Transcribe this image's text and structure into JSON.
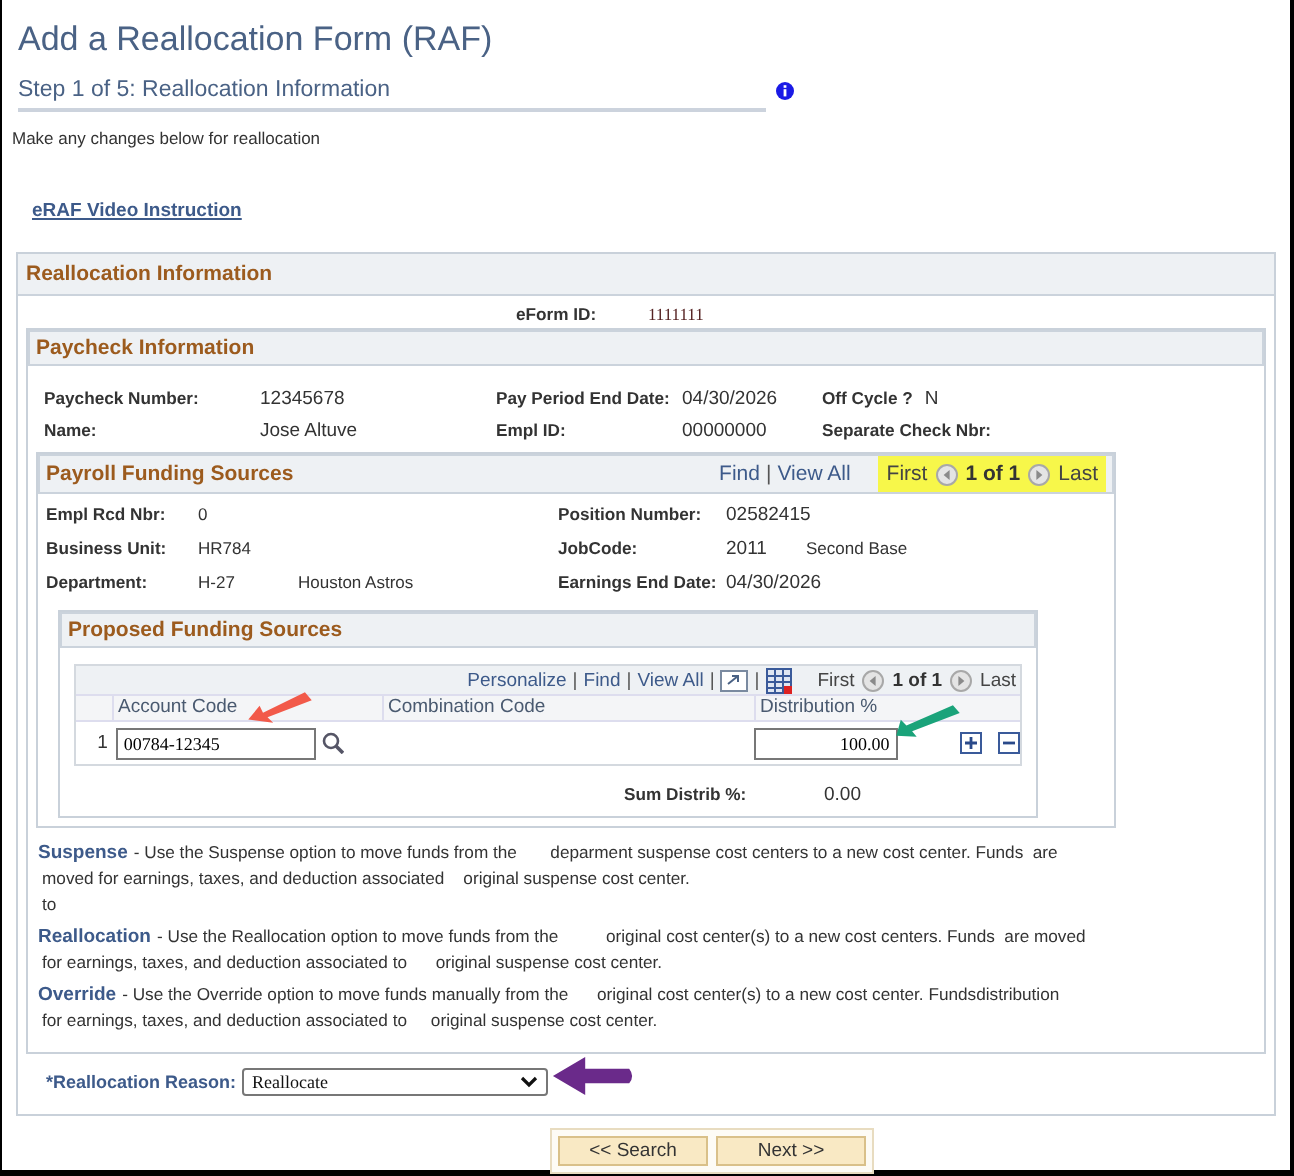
{
  "title": "Add a Reallocation Form (RAF)",
  "step": {
    "label": "Step 1 of 5: Reallocation Information"
  },
  "instructions": "Make any changes below for reallocation",
  "video_link": "eRAF Video Instruction",
  "section": {
    "title": "Reallocation Information",
    "eform": {
      "label": "eForm ID:",
      "value": "1111111"
    }
  },
  "paycheck": {
    "title": "Paycheck Information",
    "rows": [
      [
        {
          "label": "Paycheck Number:",
          "value": "12345678"
        },
        {
          "label": "Pay Period End Date:",
          "value": "04/30/2026"
        },
        {
          "label": "Off Cycle ?",
          "value": "N"
        }
      ],
      [
        {
          "label": "Name:",
          "value": "Jose Altuve"
        },
        {
          "label": "Empl ID:",
          "value": "00000000"
        },
        {
          "label": "Separate Check Nbr:"
        }
      ]
    ]
  },
  "payroll": {
    "title": "Payroll Funding Sources",
    "toolbar": [
      {
        "kind": "link",
        "text": "Find"
      },
      {
        "kind": "separator",
        "text": "|"
      },
      {
        "kind": "link",
        "text": "View All"
      }
    ],
    "nav": {
      "first": "First",
      "count": "1 of 1",
      "last": "Last",
      "highlighted": true
    },
    "rows": [
      [
        {
          "label": "Empl Rcd Nbr:",
          "value": "0"
        },
        {
          "label": "Position Number:",
          "value": "02582415"
        }
      ],
      [
        {
          "label": "Business Unit:",
          "value": "HR784"
        },
        {
          "label": "JobCode:",
          "value": "2011",
          "description": "Second Base"
        }
      ],
      [
        {
          "label": "Department:",
          "value": "H-27",
          "description": "Houston Astros"
        },
        {
          "label": "Earnings End Date:",
          "value": "04/30/2026"
        }
      ]
    ]
  },
  "proposed": {
    "title": "Proposed Funding Sources",
    "toolbar": [
      {
        "kind": "link",
        "text": "Personalize"
      },
      {
        "kind": "separator",
        "text": "|"
      },
      {
        "kind": "link",
        "text": "Find"
      },
      {
        "kind": "separator",
        "text": "|"
      },
      {
        "kind": "link",
        "text": "View All"
      },
      {
        "kind": "separator",
        "text": "|"
      },
      {
        "kind": "zoom"
      },
      {
        "kind": "separator",
        "text": "|"
      },
      {
        "kind": "spreadsheet"
      }
    ],
    "nav": {
      "first": "First",
      "count": "1 of 1",
      "last": "Last",
      "highlighted": false
    },
    "columns": [
      "Account Code",
      "Combination Code",
      "Distribution %"
    ],
    "rows": [
      {
        "number": "1",
        "account_code": "00784-12345",
        "distribution": "100.00"
      }
    ],
    "sum": {
      "label": "Sum Distrib %:",
      "value": "0.00"
    }
  },
  "descriptions": [
    {
      "term": "Suspense",
      "lines": [
        "- Use the Suspense option to move funds from the       deparment suspense cost centers to a new cost center. Funds  are",
        "moved for earnings, taxes, and deduction associated    original suspense cost center.",
        "to"
      ]
    },
    {
      "term": "Reallocation",
      "lines": [
        "- Use the Reallocation option to move funds from the          original cost center(s) to a new cost centers. Funds  are moved",
        "for earnings, taxes, and deduction associated to      original suspense cost center."
      ]
    },
    {
      "term": "Override",
      "lines": [
        "- Use the Override option to move funds manually from the      original cost center(s) to a new cost center. Fundsdistribution",
        "for earnings, taxes, and deduction associated to     original suspense cost center."
      ]
    }
  ],
  "reason": {
    "label": "*Reallocation Reason:",
    "value": "Reallocate"
  },
  "buttons": [
    "<< Search",
    "Next >>"
  ]
}
